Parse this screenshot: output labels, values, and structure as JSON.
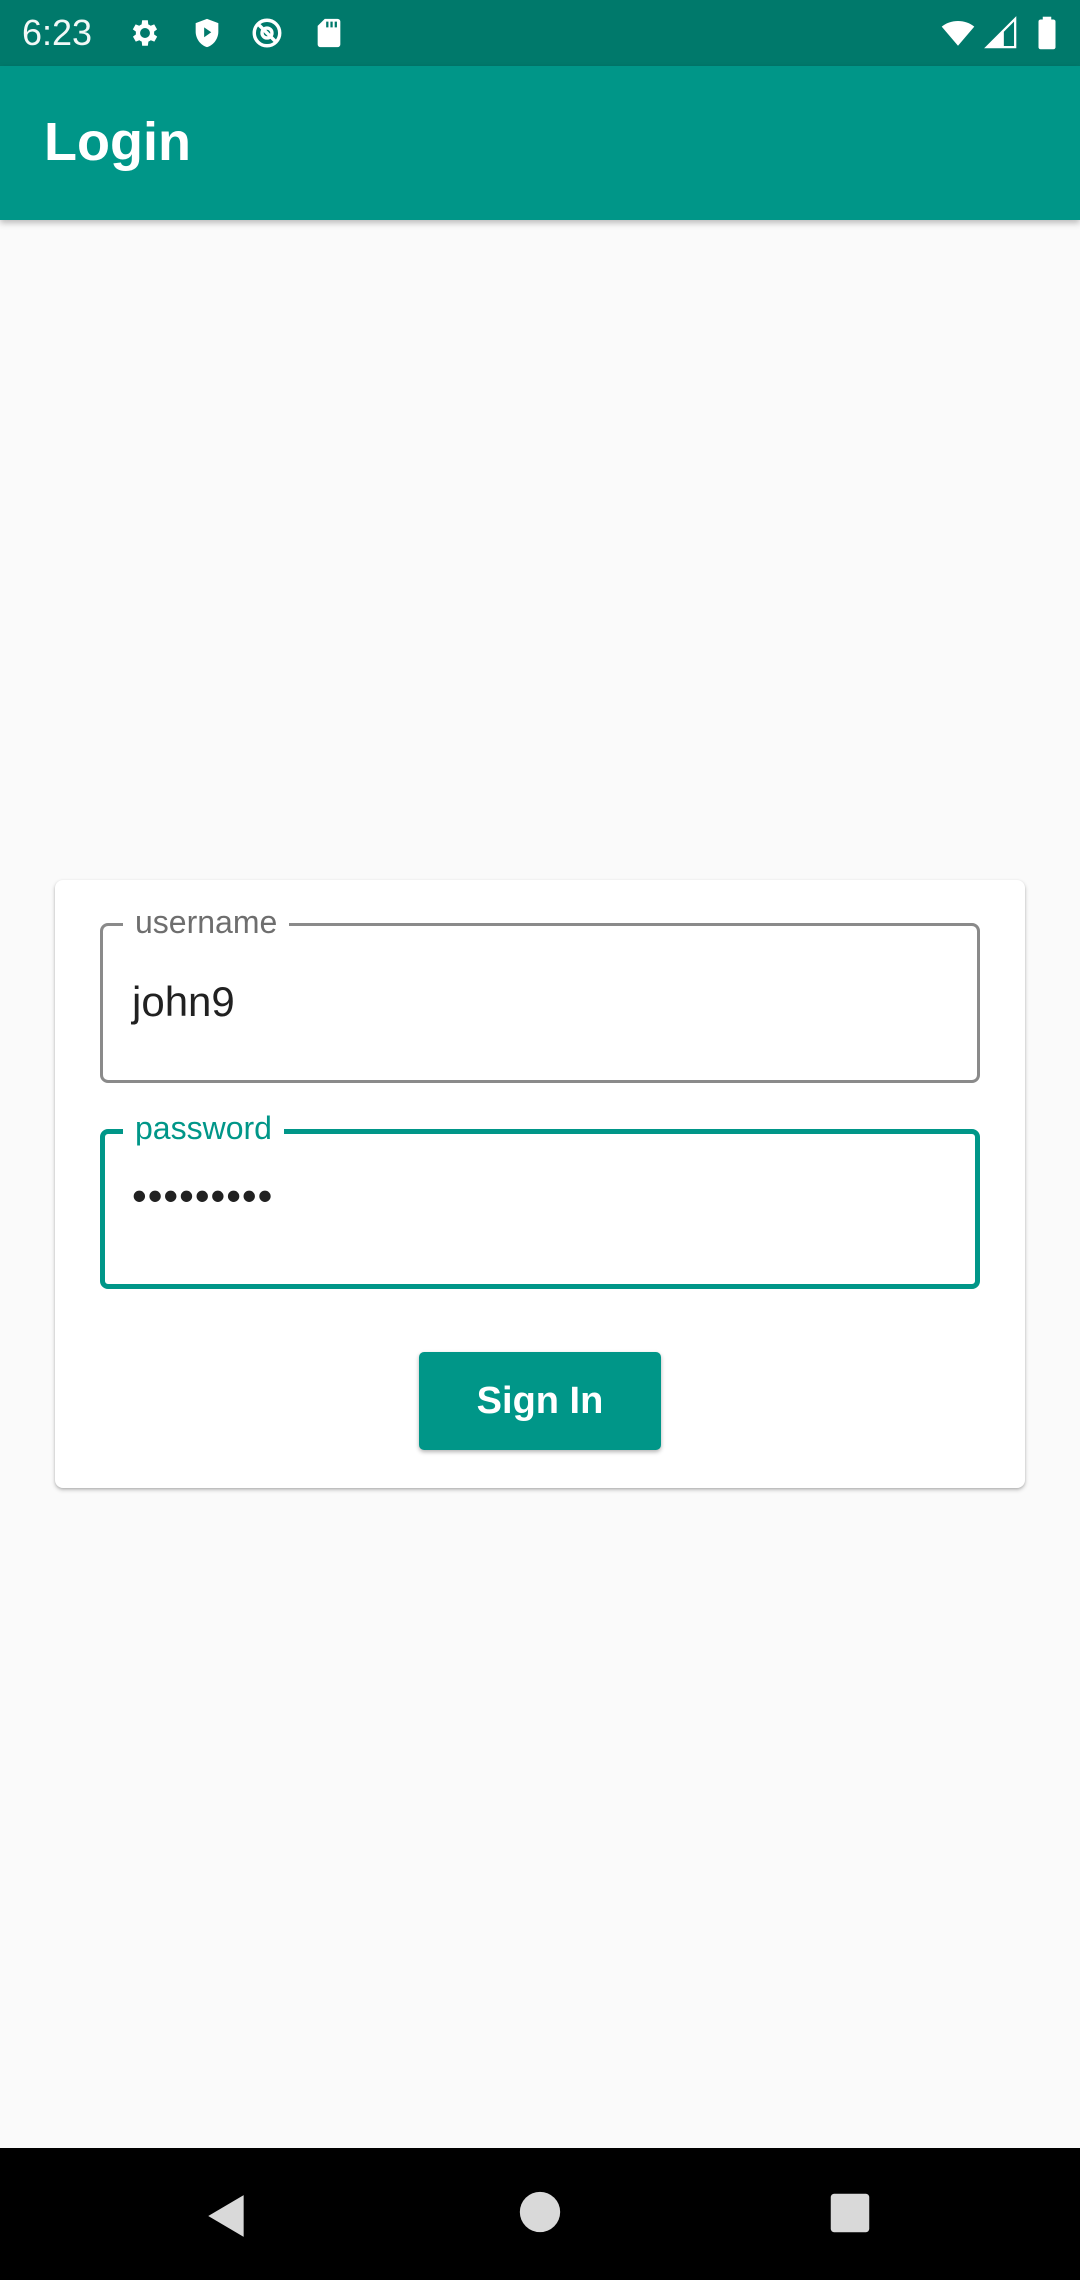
{
  "status_bar": {
    "time": "6:23",
    "left_icons": [
      "settings-icon",
      "shield-play-icon",
      "at-sign-icon",
      "sd-card-icon"
    ],
    "right_icons": [
      "wifi-icon",
      "cell-signal-icon",
      "battery-icon"
    ]
  },
  "app_bar": {
    "title": "Login",
    "color": "#009688"
  },
  "login_form": {
    "username": {
      "label": "username",
      "value": "john9"
    },
    "password": {
      "label": "password",
      "masked_value": "•••••••••"
    },
    "sign_in_label": "Sign In"
  },
  "nav_bar": {
    "buttons": [
      "back-icon",
      "home-icon",
      "recents-icon"
    ]
  },
  "colors": {
    "primary": "#009688",
    "primary_dark": "#00796B",
    "background": "#FAFAFA"
  }
}
